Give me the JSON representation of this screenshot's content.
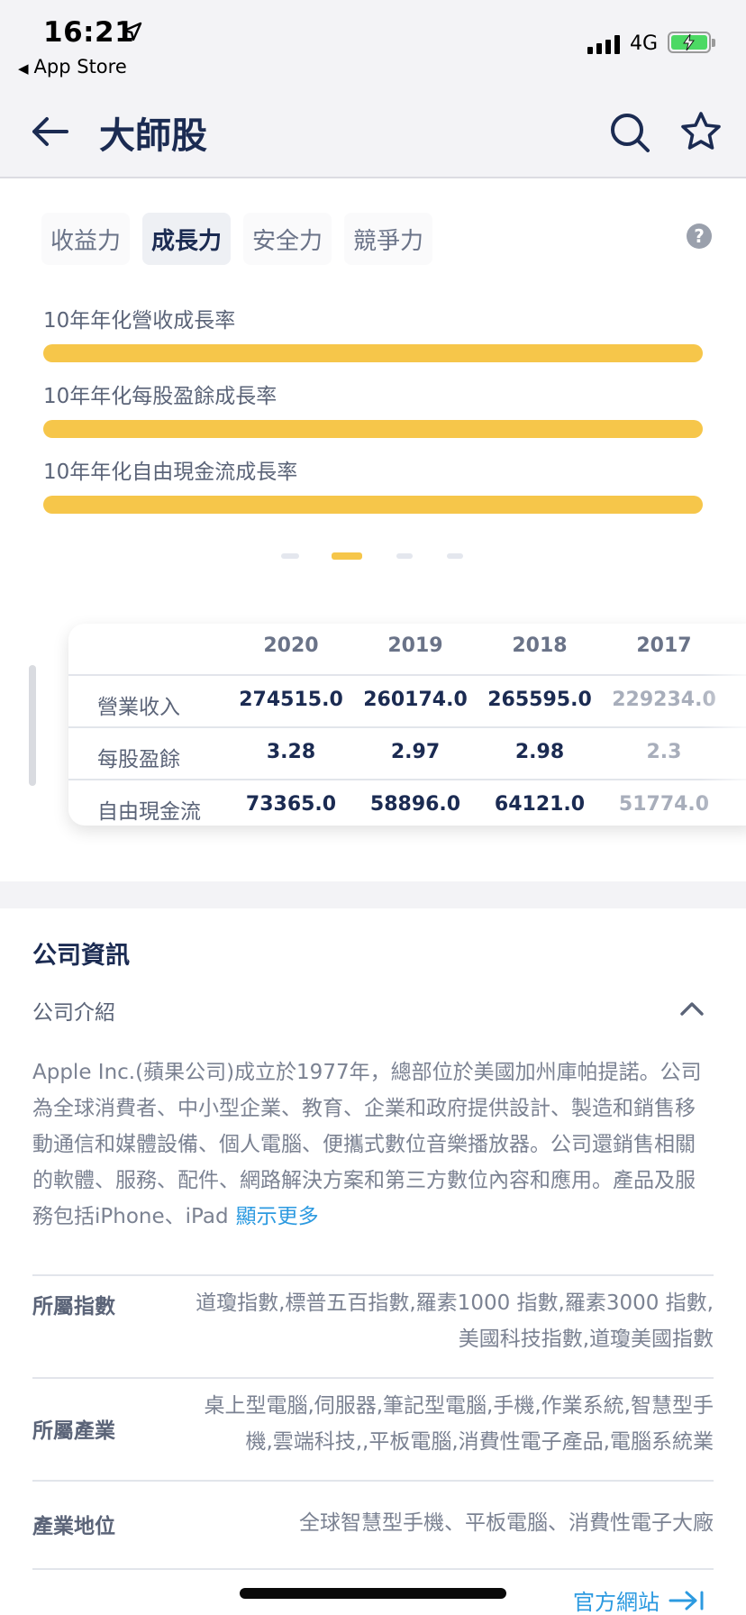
{
  "status_bar": {
    "time": "16:21",
    "back_app": "App Store",
    "network": "4G"
  },
  "header": {
    "title": "大師股"
  },
  "tabs": [
    {
      "label": "收益力",
      "active": false
    },
    {
      "label": "成長力",
      "active": true
    },
    {
      "label": "安全力",
      "active": false
    },
    {
      "label": "競爭力",
      "active": false
    }
  ],
  "growth_metrics": [
    {
      "label": "10年年化營收成長率",
      "fill": 1.0
    },
    {
      "label": "10年年化每股盈餘成長率",
      "fill": 1.0
    },
    {
      "label": "10年年化自由現金流成長率",
      "fill": 1.0
    }
  ],
  "pager": {
    "count": 4,
    "active_index": 1
  },
  "financials": {
    "years": [
      "2020",
      "2019",
      "2018",
      "2017"
    ],
    "rows": [
      {
        "label": "營業收入",
        "values": [
          "274515.0",
          "260174.0",
          "265595.0",
          "229234.0"
        ]
      },
      {
        "label": "每股盈餘",
        "values": [
          "3.28",
          "2.97",
          "2.98",
          "2.3"
        ]
      },
      {
        "label": "自由現金流",
        "values": [
          "73365.0",
          "58896.0",
          "64121.0",
          "51774.0"
        ]
      }
    ]
  },
  "company": {
    "section_title": "公司資訊",
    "intro_title": "公司介紹",
    "description": "Apple Inc.(蘋果公司)成立於1977年，總部位於美國加州庫帕提諾。公司為全球消費者、中小型企業、教育、企業和政府提供設計、製造和銷售移動通信和媒體設備、個人電腦、便攜式數位音樂播放器。公司還銷售相關的軟體、服務、配件、網路解決方案和第三方數位內容和應用。產品及服務包括iPhone、iPad",
    "show_more": "顯示更多",
    "details": [
      {
        "label": "所屬指數",
        "line1": "道瓊指數,標普五百指數,羅素1000 指數,羅素3000 指數,",
        "line2": "美國科技指數,道瓊美國指數"
      },
      {
        "label": "所屬產業",
        "line1": "桌上型電腦,伺服器,筆記型電腦,手機,作業系統,智慧型手",
        "line2": "機,雲端科技,,平板電腦,消費性電子產品,電腦系統業"
      },
      {
        "label": "產業地位",
        "line1": "全球智慧型手機、平板電腦、消費性電子大廠",
        "line2": ""
      }
    ],
    "official_site": "官方網站"
  }
}
